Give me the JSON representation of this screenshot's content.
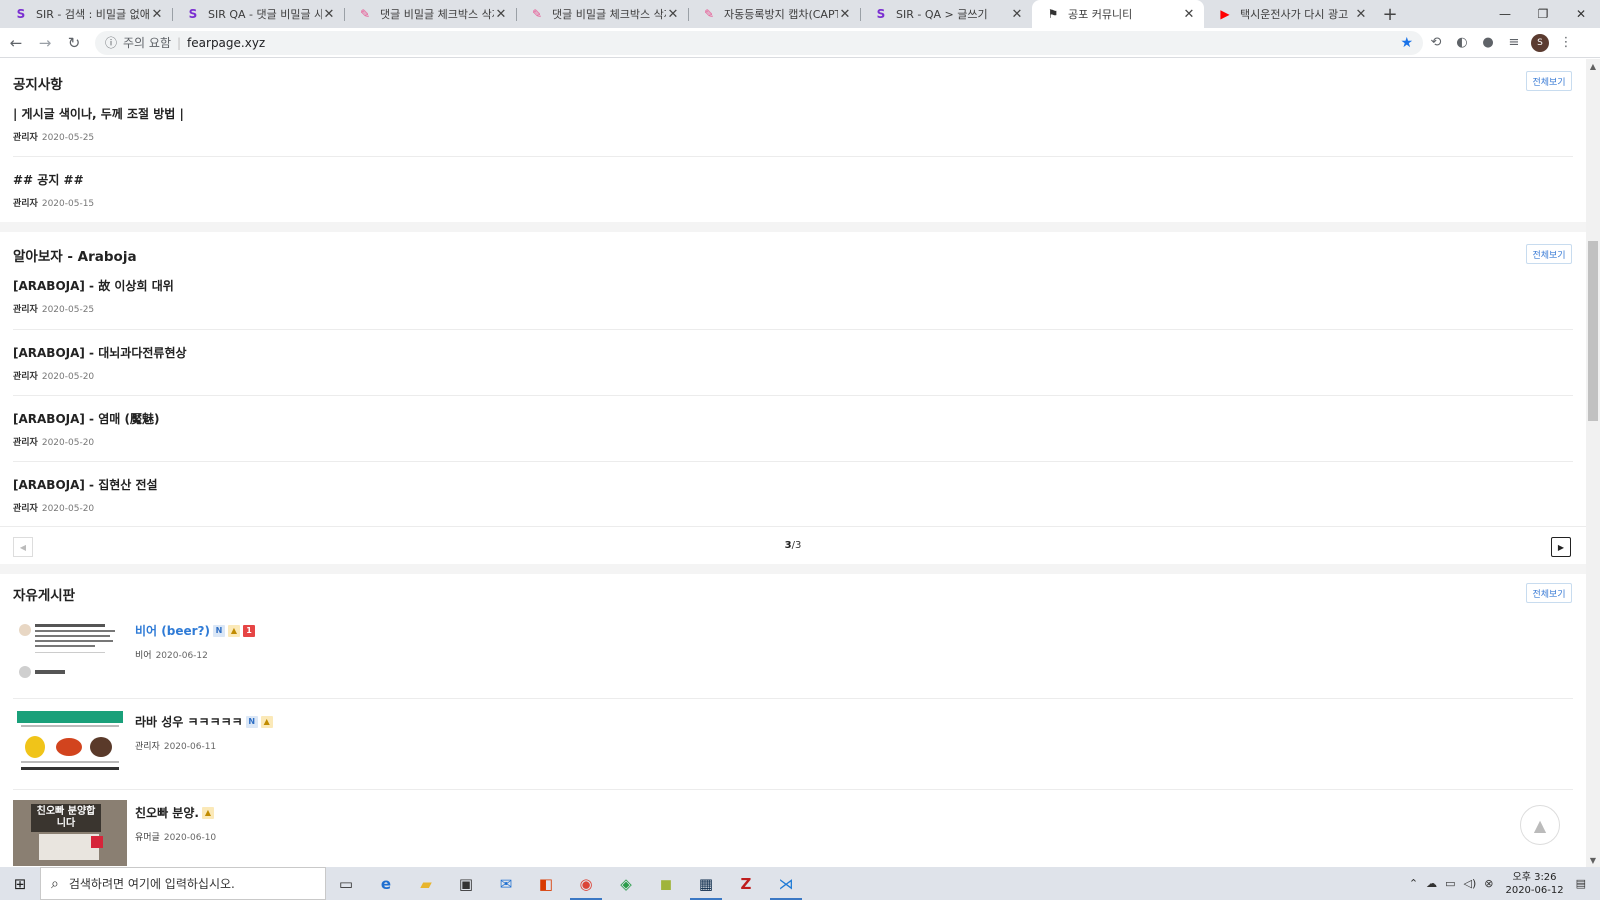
{
  "browser": {
    "tabs": [
      {
        "title": "SIR - 검색 : 비밀글 없애기",
        "icon": "S",
        "icon_color": "#7b2fd1",
        "active": false
      },
      {
        "title": "SIR QA - 댓글 비밀글 사용",
        "icon": "S",
        "icon_color": "#7b2fd1",
        "active": false
      },
      {
        "title": "댓글 비밀글 체크박스 삭제",
        "icon": "✎",
        "icon_color": "#e8518f",
        "active": false
      },
      {
        "title": "댓글 비밀글 체크박스 삭제",
        "icon": "✎",
        "icon_color": "#e8518f",
        "active": false
      },
      {
        "title": "자동등록방지 캡차(CAPTCH",
        "icon": "✎",
        "icon_color": "#e8518f",
        "active": false
      },
      {
        "title": "SIR - QA > 글쓰기",
        "icon": "S",
        "icon_color": "#7b2fd1",
        "active": false
      },
      {
        "title": "공포 커뮤니티",
        "icon": "⚑",
        "icon_color": "#333333",
        "active": true
      },
      {
        "title": "택시운전사가 다시 광고",
        "icon": "▶",
        "icon_color": "#ff0000",
        "active": false
      }
    ],
    "new_tab": "+",
    "window_controls": {
      "minimize": "—",
      "restore": "❐",
      "close": "✕"
    },
    "address": {
      "security_label": "주의 요함",
      "url": "fearpage.xyz"
    },
    "avatar_letter": "S"
  },
  "notice": {
    "title": "공지사항",
    "more": "전체보기",
    "posts": [
      {
        "title": "| 게시글 색이나, 두께 조절 방법 |",
        "author": "관리자",
        "date": "2020-05-25"
      },
      {
        "title": "## 공지 ##",
        "author": "관리자",
        "date": "2020-05-15"
      }
    ]
  },
  "araboja": {
    "title": "알아보자 - Araboja",
    "more": "전체보기",
    "posts": [
      {
        "title": "[ARABOJA] - 故 이상희 대위",
        "author": "관리자",
        "date": "2020-05-25"
      },
      {
        "title": "[ARABOJA] - 대뇌과다전류현상",
        "author": "관리자",
        "date": "2020-05-20"
      },
      {
        "title": "[ARABOJA] - 염매 (魘魅)",
        "author": "관리자",
        "date": "2020-05-20"
      },
      {
        "title": "[ARABOJA] - 집현산 전설",
        "author": "관리자",
        "date": "2020-05-20"
      }
    ],
    "pager": {
      "current": "3",
      "total": "/3"
    }
  },
  "free": {
    "title": "자유게시판",
    "more": "전체보기",
    "posts": [
      {
        "title": "비어 (beer?)",
        "author": "비어",
        "date": "2020-06-12",
        "new_badge": "N",
        "comment_count": "1"
      },
      {
        "title": "라바 성우 ㅋㅋㅋㅋㅋ",
        "author": "관리자",
        "date": "2020-06-11",
        "new_badge": "N"
      },
      {
        "title": "친오빠 분양.",
        "author": "유머글",
        "date": "2020-06-10",
        "thumb_text": "친오빠 분양합니다"
      }
    ]
  },
  "taskbar": {
    "search_placeholder": "검색하려면 여기에 입력하십시오.",
    "time": "오후 3:26",
    "date": "2020-06-12"
  }
}
